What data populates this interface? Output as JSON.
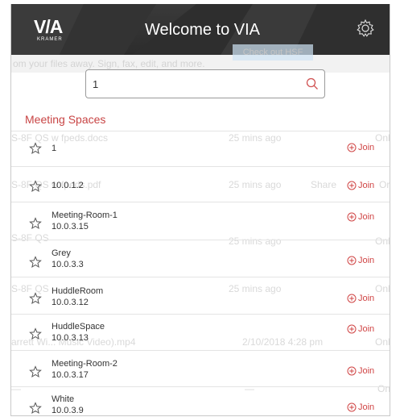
{
  "header": {
    "title": "Welcome to VIA",
    "logo_text": "V/A",
    "logo_subtext": "KRAMER",
    "background": "#2f2f2f"
  },
  "ghost": {
    "banner": "om your files away. Sign, fax, edit, and more.",
    "banner_button": "Check out HSF",
    "rows": [
      {
        "file": "S-8F QS w fpeds.docs",
        "time": "25 mins ago",
        "extra": "Onl"
      },
      {
        "file": "S-8F QS w fpeds.pdf",
        "time": "25 mins ago",
        "extra": "Share",
        "extra2": "Or"
      },
      {
        "file": "S-8F QS",
        "time": "25 mins ago",
        "extra": "Onl"
      },
      {
        "file": "S-8F QS",
        "time": "25 mins ago",
        "extra": "Onl"
      },
      {
        "file": "arrett Wi... Music Video).mp4",
        "time": "2/10/2018 4:28 pm",
        "extra": "Onl"
      },
      {
        "file": "—",
        "time": "—",
        "extra": "Onl"
      }
    ]
  },
  "search": {
    "value": "1",
    "placeholder": ""
  },
  "section_title": "Meeting Spaces",
  "join_label": "Join",
  "accent_color": "#d04545",
  "rooms": [
    {
      "name": "1",
      "ip": ""
    },
    {
      "name": "",
      "ip": "10.0.1.2"
    },
    {
      "name": "Meeting-Room-1",
      "ip": "10.0.3.15"
    },
    {
      "name": "Grey",
      "ip": "10.0.3.3"
    },
    {
      "name": "HuddleRoom",
      "ip": "10.0.3.12"
    },
    {
      "name": "HuddleSpace",
      "ip": "10.0.3.13"
    },
    {
      "name": "Meeting-Room-2",
      "ip": "10.0.3.17"
    },
    {
      "name": "White",
      "ip": "10.0.3.9"
    }
  ]
}
